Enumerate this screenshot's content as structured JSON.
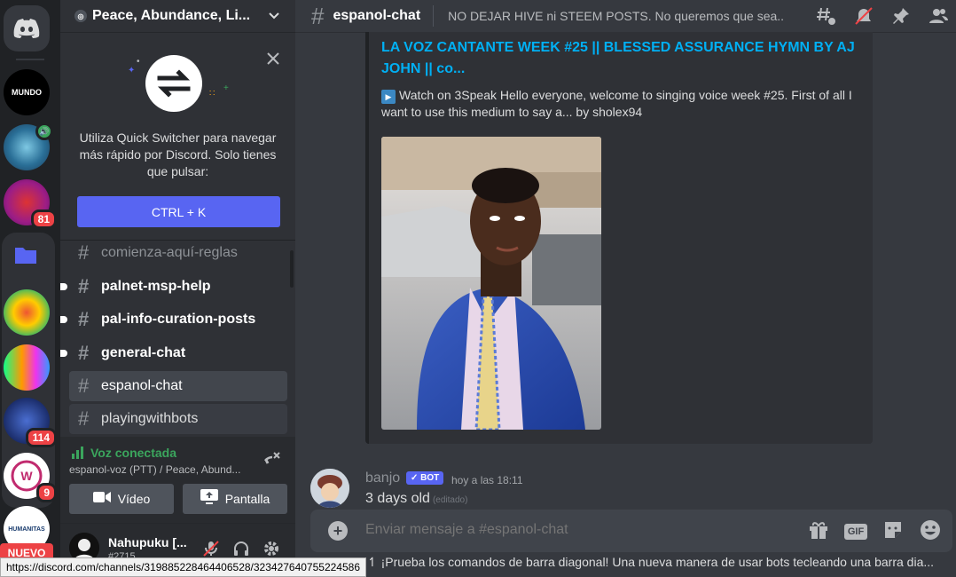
{
  "servers": {
    "items": [
      {
        "name": "home",
        "label": ""
      },
      {
        "name": "server-mundo",
        "label": "MUNDO",
        "badge": ""
      },
      {
        "name": "server-2",
        "label": "",
        "badge": ""
      },
      {
        "name": "server-3",
        "label": "",
        "badge": "81"
      },
      {
        "name": "server-folder",
        "label": ""
      },
      {
        "name": "server-5",
        "label": ""
      },
      {
        "name": "server-6",
        "label": ""
      },
      {
        "name": "server-7",
        "label": "",
        "badge": "114"
      },
      {
        "name": "server-8",
        "label": "",
        "badge": "9"
      },
      {
        "name": "server-humanitas",
        "label": "HUMANITAS"
      }
    ],
    "nuevo_label": "NUEVO"
  },
  "guild": {
    "name": "Peace, Abundance, Li..."
  },
  "quick_switcher": {
    "text": "Utiliza Quick Switcher para navegar más rápido por Discord. Solo tienes que pulsar:",
    "button_label": "CTRL + K"
  },
  "channels": [
    {
      "name": "comienza-aquí-reglas",
      "state": "muted"
    },
    {
      "name": "palnet-msp-help",
      "state": "unread"
    },
    {
      "name": "pal-info-curation-posts",
      "state": "unread"
    },
    {
      "name": "general-chat",
      "state": "unread"
    },
    {
      "name": "espanol-chat",
      "state": "active"
    },
    {
      "name": "playingwithbots",
      "state": "hover"
    }
  ],
  "voice": {
    "status": "Voz conectada",
    "channel": "espanol-voz (PTT) / Peace, Abund...",
    "video_label": "Vídeo",
    "screen_label": "Pantalla"
  },
  "user": {
    "name": "Nahupuku [...",
    "tag": "#2715"
  },
  "url_tooltip": "https://discord.com/channels/319885228464406528/323427640755224586",
  "chat": {
    "channel_name": "espanol-chat",
    "topic": "NO DEJAR HIVE ni STEEM POSTS. No queremos que sea...",
    "embed": {
      "title": "LA VOZ CANTANTE WEEK #25 || BLESSED ASSURANCE HYMN BY AJ JOHN || co...",
      "description": "Watch on 3Speak Hello everyone, welcome to singing voice week #25. First of all I want to use this medium to say a... by sholex94"
    },
    "message": {
      "author": "banjo",
      "bot_tag": "BOT",
      "time": "hoy a las 18:11",
      "text": "3 days old",
      "edited": "(editado)"
    },
    "composer_placeholder": "Enviar mensaje a #espanol-chat",
    "tip": "¡Prueba los comandos de barra diagonal! Una nueva manera de usar bots tecleando una barra dia..."
  },
  "colors": {
    "accent": "#5865f2",
    "link": "#00b0f4",
    "voice_green": "#3ba55d",
    "badge_red": "#ed4245"
  }
}
